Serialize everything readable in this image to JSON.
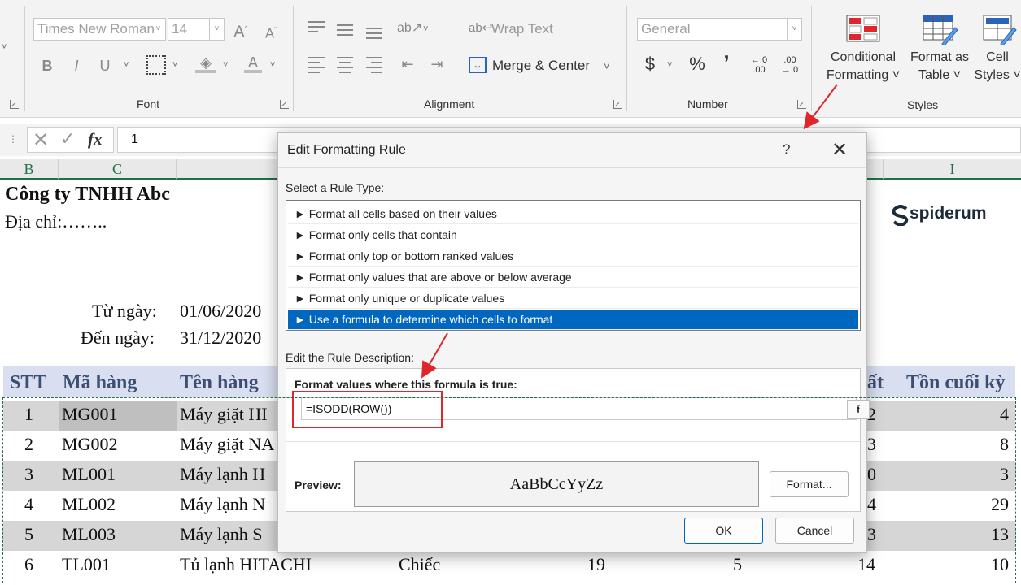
{
  "ribbon": {
    "font_group_label": "Font",
    "font_name": "Times New Roman",
    "font_size": "14",
    "alignment_group_label": "Alignment",
    "wrap_text_label": "Wrap Text",
    "merge_center_label": "Merge & Center",
    "number_group_label": "Number",
    "number_format": "General",
    "currency_symbol": "$",
    "percent_symbol": "%",
    "comma_symbol": "ʼ",
    "increase_decimal_label": "←.0 .00",
    "decrease_decimal_label": ".00 →.0",
    "styles_group_label": "Styles",
    "conditional_formatting_line1": "Conditional",
    "conditional_formatting_line2": "Formatting ˅",
    "format_as_table_line1": "Format as",
    "format_as_table_line2": "Table ˅",
    "cell_styles_line1": "Cell",
    "cell_styles_line2": "Styles ˅"
  },
  "formula_bar": {
    "fx_label": "fx",
    "value": "1"
  },
  "sheet": {
    "columns": [
      "B",
      "C",
      "I"
    ],
    "company": "Công ty TNHH Abc",
    "address": "Địa chỉ:……..",
    "from_label": "Từ ngày:",
    "from_value": "01/06/2020",
    "to_label": "Đến ngày:",
    "to_value": "31/12/2020",
    "brand": "spiderum",
    "headers": {
      "stt": "STT",
      "code": "Mã hàng",
      "name": "Tên hàng",
      "partial": "ất",
      "end_stock": "Tồn cuối kỳ"
    },
    "rows": [
      {
        "stt": "1",
        "code": "MG001",
        "name": "Máy giặt HI",
        "partial": "2",
        "end": "4"
      },
      {
        "stt": "2",
        "code": "MG002",
        "name": "Máy giặt NA",
        "partial": "3",
        "end": "8"
      },
      {
        "stt": "3",
        "code": "ML001",
        "name": "Máy lạnh H",
        "partial": "0",
        "end": "3"
      },
      {
        "stt": "4",
        "code": "ML002",
        "name": "Máy lạnh N",
        "partial": "4",
        "end": "29"
      },
      {
        "stt": "5",
        "code": "ML003",
        "name": "Máy lạnh S",
        "partial": "3",
        "end": "13"
      },
      {
        "stt": "6",
        "code": "TL001",
        "name": "Tủ lạnh HITACHI",
        "unit": "Chiếc",
        "v1": "19",
        "v2": "5",
        "partial": "14",
        "end": "10"
      }
    ]
  },
  "dialog": {
    "title": "Edit Formatting Rule",
    "help": "?",
    "close": "✕",
    "select_rule_label": "Select a Rule Type:",
    "rule_types": [
      "► Format all cells based on their values",
      "► Format only cells that contain",
      "► Format only top or bottom ranked values",
      "► Format only values that are above or below average",
      "► Format only unique or duplicate values",
      "► Use a formula to determine which cells to format"
    ],
    "edit_desc_label": "Edit the Rule Description:",
    "formula_label": "Format values where this formula is true:",
    "formula_value": "=ISODD(ROW())",
    "preview_label": "Preview:",
    "preview_text": "AaBbCcYyZz",
    "format_button": "Format...",
    "ok_button": "OK",
    "cancel_button": "Cancel"
  },
  "colors": {
    "selection_blue": "#0067c0",
    "excel_green": "#1e7145",
    "annotation_red": "#e0262b",
    "header_text": "#3c4e72",
    "band_gray": "#d6d6d6"
  }
}
